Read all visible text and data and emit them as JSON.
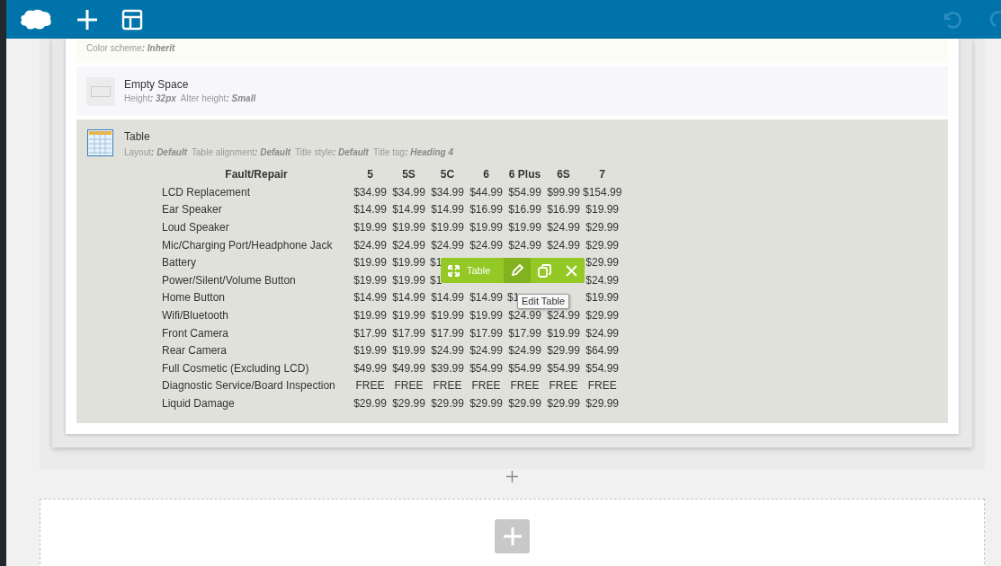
{
  "elements": [
    {
      "kind": "partial",
      "params": [
        {
          "label": "Color scheme",
          "value": ": Inherit"
        }
      ]
    },
    {
      "kind": "spacer",
      "title": "Empty Space",
      "params": [
        {
          "label": "Height",
          "value": ": 32px"
        },
        {
          "label": "Alter height",
          "value": ": Small"
        }
      ]
    },
    {
      "kind": "table",
      "title": "Table",
      "selected": true,
      "params": [
        {
          "label": "Layout",
          "value": ": Default"
        },
        {
          "label": "Table alignment",
          "value": ": Default"
        },
        {
          "label": "Title style",
          "value": ": Default"
        },
        {
          "label": "Title tag",
          "value": ": Heading 4"
        }
      ],
      "table": {
        "columns": [
          "Fault/Repair",
          "5",
          "5S",
          "5C",
          "6",
          "6 Plus",
          "6S",
          "7"
        ],
        "rows": [
          [
            "LCD Replacement",
            "$34.99",
            "$34.99",
            "$34.99",
            "$44.99",
            "$54.99",
            "$99.99",
            "$154.99"
          ],
          [
            "Ear Speaker",
            "$14.99",
            "$14.99",
            "$14.99",
            "$16.99",
            "$16.99",
            "$16.99",
            "$19.99"
          ],
          [
            "Loud Speaker",
            "$19.99",
            "$19.99",
            "$19.99",
            "$19.99",
            "$19.99",
            "$24.99",
            "$29.99"
          ],
          [
            "Mic/Charging Port/Headphone Jack",
            "$24.99",
            "$24.99",
            "$24.99",
            "$24.99",
            "$24.99",
            "$24.99",
            "$29.99"
          ],
          [
            "Battery",
            "$19.99",
            "$19.99",
            "$1",
            null,
            null,
            null,
            "$29.99"
          ],
          [
            "Power/Silent/Volume Button",
            "$19.99",
            "$19.99",
            "$1",
            null,
            null,
            null,
            "$24.99"
          ],
          [
            "Home Button",
            "$14.99",
            "$14.99",
            "$14.99",
            "$14.99",
            "$1",
            null,
            "$19.99"
          ],
          [
            "Wifi/Bluetooth",
            "$19.99",
            "$19.99",
            "$19.99",
            "$19.99",
            "$24.99",
            "$24.99",
            "$29.99"
          ],
          [
            "Front Camera",
            "$17.99",
            "$17.99",
            "$17.99",
            "$17.99",
            "$17.99",
            "$19.99",
            "$24.99"
          ],
          [
            "Rear Camera",
            "$19.99",
            "$19.99",
            "$24.99",
            "$24.99",
            "$24.99",
            "$29.99",
            "$64.99"
          ],
          [
            "Full Cosmetic (Excluding LCD)",
            "$49.99",
            "$49.99",
            "$39.99",
            "$54.99",
            "$54.99",
            "$54.99",
            "$54.99"
          ],
          [
            "Diagnostic Service/Board Inspection",
            "FREE",
            "FREE",
            "FREE",
            "FREE",
            "FREE",
            "FREE",
            "FREE"
          ],
          [
            "Liquid Damage",
            "$29.99",
            "$29.99",
            "$29.99",
            "$29.99",
            "$29.99",
            "$29.99",
            "$29.99"
          ]
        ]
      },
      "controls": {
        "label": "Table",
        "tooltip": "Edit Table"
      }
    }
  ]
}
